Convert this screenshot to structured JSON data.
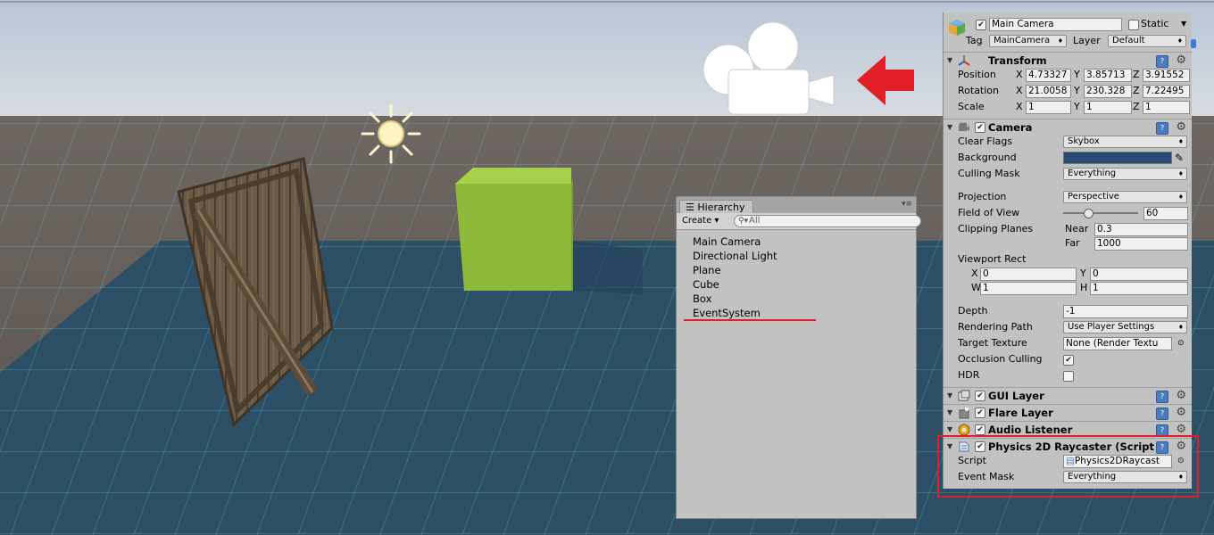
{
  "hierarchy": {
    "tab_label": "Hierarchy",
    "create_label": "Create",
    "search_placeholder": "All",
    "items": [
      "Main Camera",
      "Directional Light",
      "Plane",
      "Cube",
      "Box",
      "EventSystem"
    ]
  },
  "inspector": {
    "object_name": "Main Camera",
    "static_label": "Static",
    "tag_label": "Tag",
    "tag_value": "MainCamera",
    "layer_label": "Layer",
    "layer_value": "Default",
    "transform": {
      "title": "Transform",
      "position_label": "Position",
      "rotation_label": "Rotation",
      "scale_label": "Scale",
      "x": "X",
      "y": "Y",
      "z": "Z",
      "position": [
        "4.73327",
        "3.85713",
        "3.91552"
      ],
      "rotation": [
        "21.0058",
        "230.328",
        "7.22495"
      ],
      "scale": [
        "1",
        "1",
        "1"
      ]
    },
    "camera": {
      "title": "Camera",
      "clear_flags_label": "Clear Flags",
      "clear_flags_value": "Skybox",
      "background_label": "Background",
      "background_color": "#2b4a73",
      "culling_mask_label": "Culling Mask",
      "culling_mask_value": "Everything",
      "projection_label": "Projection",
      "projection_value": "Perspective",
      "fov_label": "Field of View",
      "fov_value": "60",
      "clipping_label": "Clipping Planes",
      "near_label": "Near",
      "near_value": "0.3",
      "far_label": "Far",
      "far_value": "1000",
      "viewport_label": "Viewport Rect",
      "vp_x_label": "X",
      "vp_x": "0",
      "vp_y_label": "Y",
      "vp_y": "0",
      "vp_w_label": "W",
      "vp_w": "1",
      "vp_h_label": "H",
      "vp_h": "1",
      "depth_label": "Depth",
      "depth_value": "-1",
      "rendering_path_label": "Rendering Path",
      "rendering_path_value": "Use Player Settings",
      "target_texture_label": "Target Texture",
      "target_texture_value": "None (Render Textu",
      "occlusion_label": "Occlusion Culling",
      "hdr_label": "HDR"
    },
    "gui_layer_title": "GUI Layer",
    "flare_layer_title": "Flare Layer",
    "audio_listener_title": "Audio Listener",
    "raycaster": {
      "title": "Physics 2D Raycaster (Script",
      "script_label": "Script",
      "script_value": "Physics2DRaycast",
      "event_mask_label": "Event Mask",
      "event_mask_value": "Everything"
    }
  },
  "colors": {
    "highlight_red": "#e01f26",
    "cube_green": "#8fb93a",
    "plane_blue": "#2d4f66"
  },
  "icons": [
    "sun-gizmo-icon",
    "camera-gizmo-icon",
    "red-arrow-icon",
    "gear-icon",
    "help-icon",
    "search-icon"
  ]
}
